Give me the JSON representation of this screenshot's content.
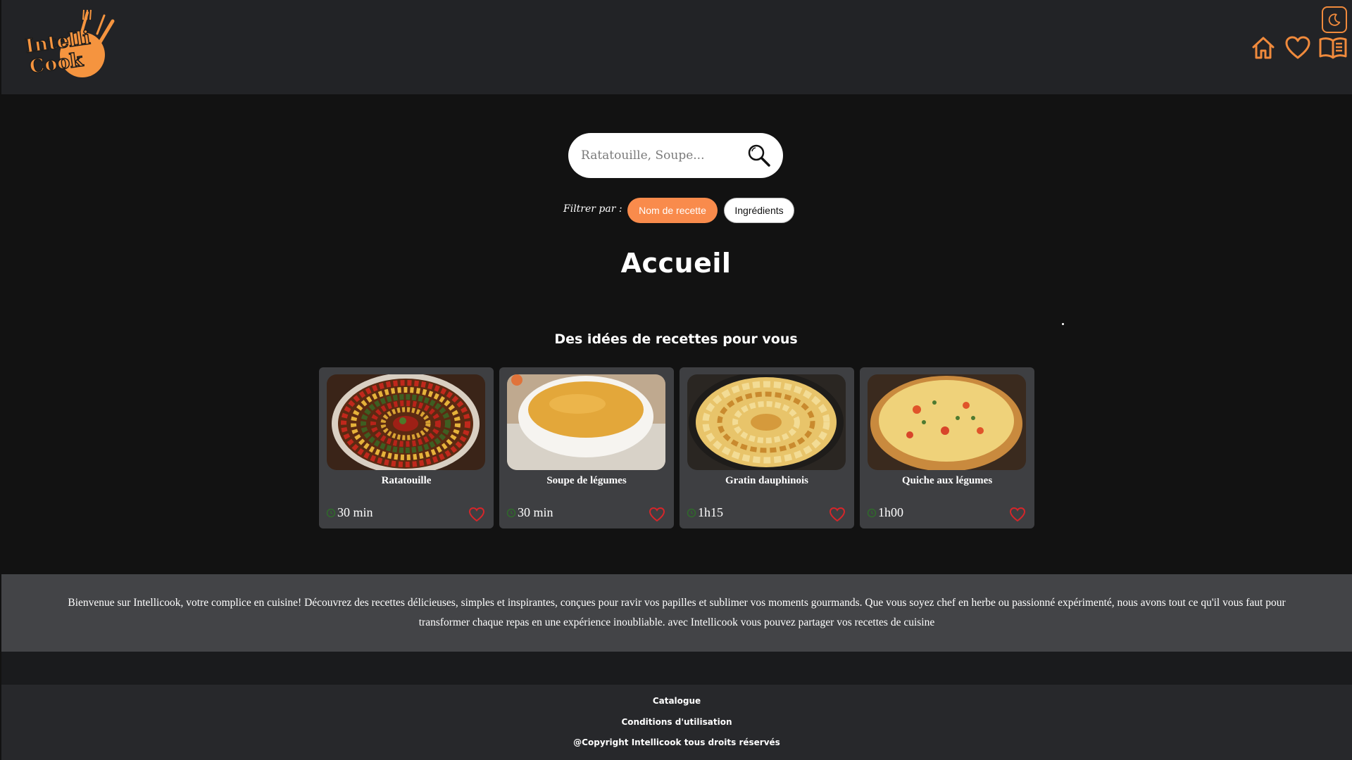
{
  "header": {
    "logo_text_top": "Intelli",
    "logo_text_bottom": "Cook",
    "theme_icon": "moon-icon",
    "nav": [
      {
        "icon": "home-icon"
      },
      {
        "icon": "heart-icon"
      },
      {
        "icon": "book-icon"
      }
    ],
    "accent_color": "#f08a3c"
  },
  "search": {
    "placeholder": "Ratatouille, Soupe...",
    "value": "",
    "icon": "search-icon"
  },
  "filter": {
    "label": "Filtrer par :",
    "options": [
      {
        "label": "Nom de recette",
        "active": true
      },
      {
        "label": "Ingrédients",
        "active": false
      }
    ]
  },
  "main": {
    "title": "Accueil",
    "section_title": "Des idées de recettes pour vous"
  },
  "recipes": [
    {
      "name": "Ratatouille",
      "time": "30 min"
    },
    {
      "name": "Soupe de légumes",
      "time": "30 min"
    },
    {
      "name": "Gratin dauphinois",
      "time": "1h15"
    },
    {
      "name": "Quiche aux légumes",
      "time": "1h00"
    }
  ],
  "intro": {
    "text": "Bienvenue sur Intellicook, votre complice en cuisine! Découvrez des recettes délicieuses, simples et inspirantes, conçues pour ravir vos papilles et sublimer vos moments gourmands. Que vous soyez chef en herbe ou passionné expérimenté, nous avons tout ce qu'il vous faut pour transformer chaque repas en une expérience inoubliable. avec Intellicook vous pouvez partager vos recettes de cuisine"
  },
  "footer": {
    "catalogue": "Catalogue",
    "terms": "Conditions d'utilisation",
    "copyright": "@Copyright Intellicook tous droits réservés"
  }
}
